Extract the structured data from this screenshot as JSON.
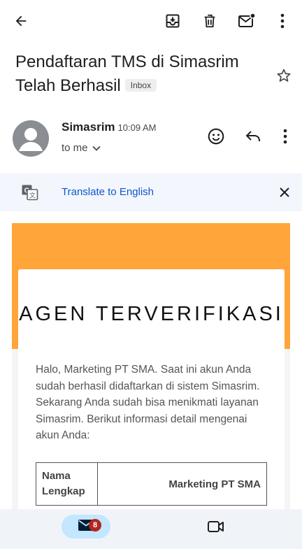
{
  "subject": {
    "line1": "Pendaftaran TMS di Simasrim",
    "line2": "Telah Berhasil",
    "label": "Inbox"
  },
  "sender": {
    "name": "Simasrim",
    "time": "10:09 AM",
    "recipient": "to me"
  },
  "translate": {
    "link": "Translate to English"
  },
  "email": {
    "title": "AGEN TERVERIFIKASI",
    "body": "Halo, Marketing PT SMA. Saat ini akun Anda sudah berhasil didaftarkan di sistem Simasrim. Sekarang Anda sudah bisa menikmati layanan Simasrim. Berikut informasi detail mengenai akun Anda:",
    "table": [
      {
        "key": "Nama Lengkap",
        "value": "Marketing PT SMA"
      }
    ]
  },
  "bottom_nav": {
    "mail_badge": "8"
  },
  "colors": {
    "accent": "#ffa53a",
    "link": "#0b57d0",
    "badge": "#b3261e",
    "nav_active": "#c2e7ff"
  },
  "icons": [
    "back-arrow-icon",
    "archive-icon",
    "trash-icon",
    "mark-unread-icon",
    "more-vert-icon",
    "star-icon",
    "avatar-icon",
    "emoji-icon",
    "reply-icon",
    "translate-icon",
    "close-icon",
    "chevron-down-icon",
    "mail-icon",
    "video-icon"
  ]
}
